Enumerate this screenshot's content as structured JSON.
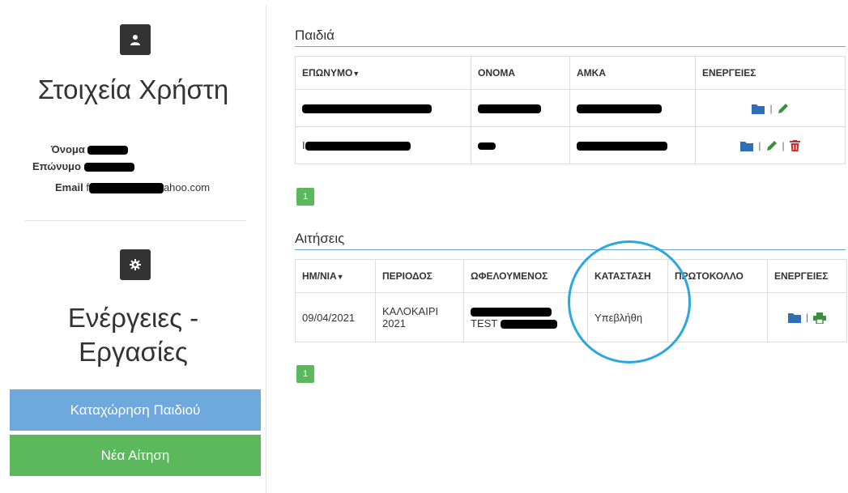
{
  "sidebar": {
    "user_title": "Στοιχεία Χρήστη",
    "name_label": "Όνομα",
    "surname_label": "Επώνυμο",
    "email_label": "Email",
    "email_prefix": "f",
    "email_suffix": "ahoo.com",
    "actions_title_line1": "Ενέργειες -",
    "actions_title_line2": "Εργασίες",
    "register_child_button": "Καταχώρηση Παιδιού",
    "new_application_button": "Νέα Αίτηση"
  },
  "children": {
    "title": "Παιδιά",
    "columns": [
      "ΕΠΩΝΥΜΟ",
      "ΟΝΟΜΑ",
      "ΑΜΚΑ",
      "ΕΝΕΡΓΕΙΕΣ"
    ],
    "rows": [
      {
        "surname": "",
        "name": "",
        "amka": "",
        "actions": [
          "folder-icon",
          "pencil-icon"
        ]
      },
      {
        "surname": "I",
        "name": "",
        "amka": "",
        "actions": [
          "folder-icon",
          "pencil-icon",
          "trash-icon"
        ]
      }
    ],
    "page": "1"
  },
  "applications": {
    "title": "Αιτήσεις",
    "columns": [
      "ΗΜ/ΝΙΑ",
      "ΠΕΡΙΟΔΟΣ",
      "ΩΦΕΛΟΥΜΕΝΟΣ",
      "ΚΑΤΑΣΤΑΣΗ",
      "ΠΡΩΤΟΚΟΛΛΟ",
      "ΕΝΕΡΓΕΙΕΣ"
    ],
    "rows": [
      {
        "date": "09/04/2021",
        "period_line1": "ΚΑΛΟΚΑΙΡΙ",
        "period_line2": "2021",
        "beneficiary_suffix": "TEST",
        "status": "Υπεβλήθη",
        "protocol": "",
        "actions": [
          "folder-icon",
          "print-icon"
        ]
      }
    ],
    "page": "1"
  },
  "colors": {
    "blue_button": "#6fa8dc",
    "green_button": "#5cb85c",
    "folder": "#2f6fb5",
    "pencil": "#3c8d3c",
    "trash": "#c9302c",
    "circle": "#2aa7e0"
  }
}
